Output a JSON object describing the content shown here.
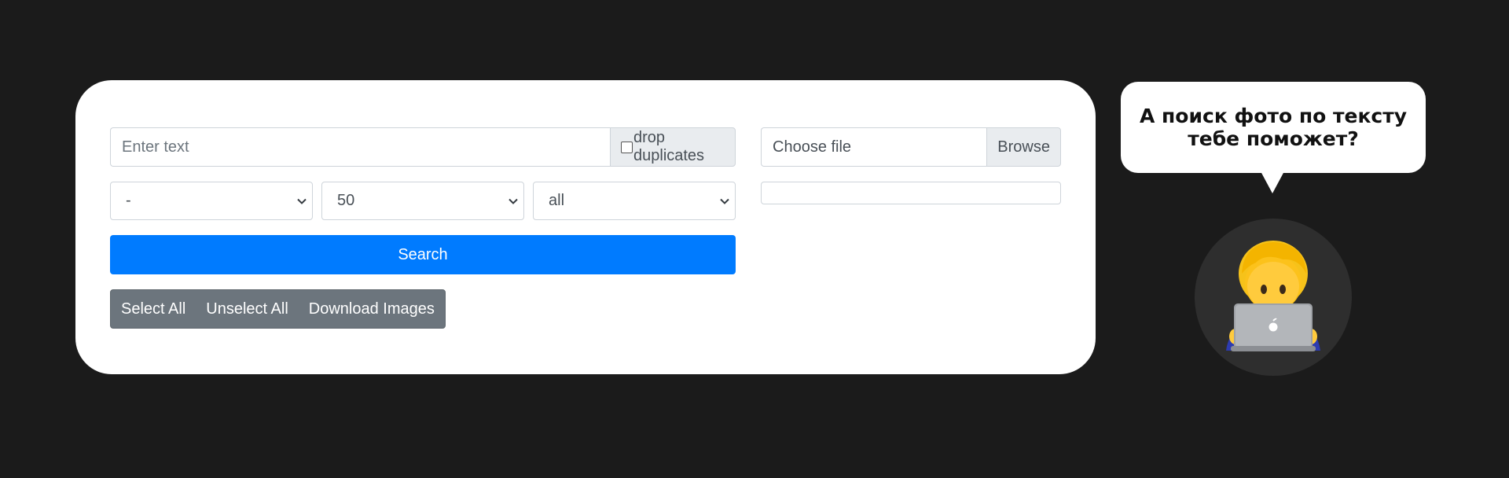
{
  "search": {
    "placeholder": "Enter text",
    "drop_duplicates_label": "drop duplicates",
    "search_button_label": "Search"
  },
  "filters": [
    {
      "name": "category",
      "selected": "-"
    },
    {
      "name": "count",
      "selected": "50"
    },
    {
      "name": "scope",
      "selected": "all"
    }
  ],
  "actions": {
    "select_all": "Select All",
    "unselect_all": "Unselect All",
    "download_images": "Download Images"
  },
  "file_upload": {
    "placeholder": "Choose file",
    "browse_label": "Browse"
  },
  "promo": {
    "bubble_line1": "А поиск фото по тексту",
    "bubble_line2": "тебе поможет?",
    "avatar_icon": "person-with-laptop-icon"
  },
  "colors": {
    "background": "#1b1b1b",
    "primary": "#007bff",
    "secondary": "#6c757d"
  }
}
